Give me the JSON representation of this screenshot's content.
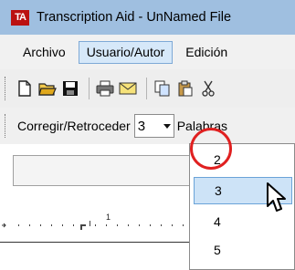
{
  "window": {
    "title": "Transcription Aid - UnNamed File",
    "app_icon_text": "TA"
  },
  "menu": {
    "items": [
      "Archivo",
      "Usuario/Autor",
      "Edición"
    ],
    "active_index": 1
  },
  "toolbar": {
    "buttons": [
      "new-document-icon",
      "open-folder-icon",
      "save-icon",
      "print-icon",
      "email-icon",
      "copy-icon",
      "paste-icon",
      "cut-icon"
    ]
  },
  "correction_toolbar": {
    "label": "Corregir/Retroceder",
    "selected_value": "3",
    "next_label": "Palabras"
  },
  "ruler": {
    "marker": "1"
  },
  "dropdown": {
    "options": [
      "2",
      "3",
      "4",
      "5"
    ],
    "selected": "3"
  },
  "colors": {
    "titlebar": "#9fbfe0",
    "selection": "#cde3f7",
    "annotation": "#e02020"
  }
}
